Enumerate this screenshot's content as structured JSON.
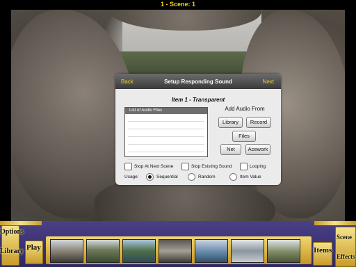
{
  "window": {
    "title": "1 - Scene: 1"
  },
  "dialog": {
    "title": "Setup Responding Sound",
    "back_label": "Back",
    "next_label": "Next",
    "item_title": "Item 1 - Transparent",
    "audio_list_header": "List of Audio Files",
    "add_audio_label": "Add Audio From",
    "buttons": {
      "library": "Library",
      "record": "Record",
      "files": "Files",
      "net": "Net",
      "acework": "Acework"
    },
    "checkboxes": {
      "stop_at_next_scene": "Stop At Next Scene",
      "stop_existing_sound": "Stop Existing Sound",
      "looping": "Looping"
    },
    "usage_label": "Usage:",
    "usage_options": {
      "sequential": "Sequential",
      "random": "Random",
      "item_value": "Item Value"
    },
    "usage_selected": "sequential"
  },
  "toolbar": {
    "options_label": "Options",
    "library_label": "Library",
    "play_label": "Play",
    "items_label": "Items",
    "scene_label": "Scene",
    "effects_label": "Effects"
  },
  "colors": {
    "accent_yellow": "#f2d21a",
    "toolbar_purple": "#3a3376",
    "gold": "#d9b648"
  }
}
